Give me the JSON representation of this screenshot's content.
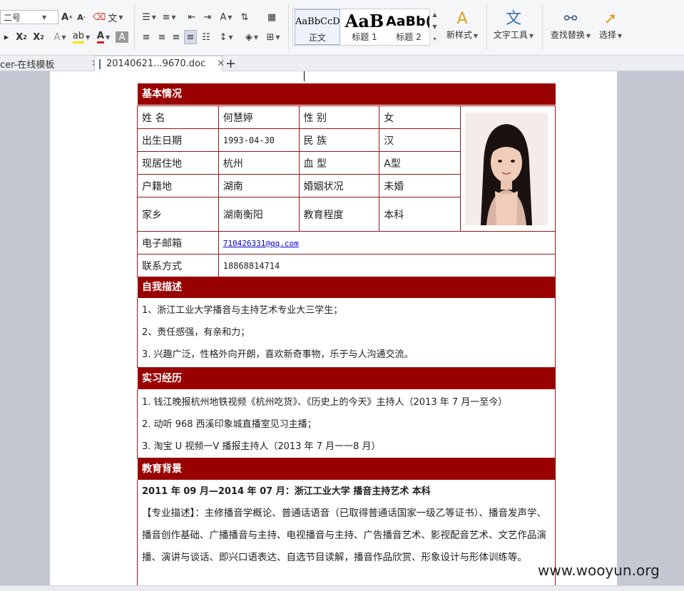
{
  "ribbon": {
    "font_size_value": "二号",
    "styles": [
      {
        "sample": "AaBbCcD",
        "name": "正文"
      },
      {
        "sample": "AaB",
        "name": "标题 1"
      },
      {
        "sample": "AaBb(",
        "name": "标题 2"
      }
    ],
    "new_style_label": "新样式",
    "text_tools_label": "文字工具",
    "find_replace_label": "查找替换",
    "select_label": "选择"
  },
  "doc_tabs": [
    {
      "label": "cer-在线模板"
    },
    {
      "label": "20140621...9670.doc"
    }
  ],
  "resume": {
    "sections": {
      "basic": "基本情况",
      "self": "自我描述",
      "intern": "实习经历",
      "edu": "教育背景"
    },
    "fields": {
      "name_label": "姓 名",
      "name": "何慧婷",
      "gender_label": "性 别",
      "gender": "女",
      "birth_label": "出生日期",
      "birth": "1993-04-30",
      "ethnic_label": "民 族",
      "ethnic": "汉",
      "residence_label": "现居住地",
      "residence": "杭州",
      "blood_label": "血 型",
      "blood": "A型",
      "hukou_label": "户籍地",
      "hukou": "湖南",
      "marital_label": "婚姻状况",
      "marital": "未婚",
      "hometown_label": "家乡",
      "hometown": "湖南衡阳",
      "degree_label": "教育程度",
      "degree": "本科",
      "email_label": "电子邮箱",
      "email": "710426331@qq.com",
      "phone_label": "联系方式",
      "phone": "18868814714"
    },
    "self_lines": [
      "1、浙江工业大学播音与主持艺术专业大三学生；",
      "2、责任感强，有亲和力；",
      "3. 兴趣广泛，性格外向开朗，喜欢新奇事物，乐于与人沟通交流。"
    ],
    "intern_lines": [
      "1.  钱江晚报杭州地铁视频《杭州吃货》、《历史上的今天》主持人（2013 年 7 月一至今）",
      "2.  动听 968 西溪印象城直播室见习主播；",
      "3.  淘宝 U 视频一V 播报主持人（2013 年 7 月一一8 月）"
    ],
    "edu_title": "2011 年 09 月—2014 年 07 月：浙江工业大学   播音主持艺术   本科",
    "edu_desc": "【专业描述】：主修播音学概论、普通话语音（已取得普通话国家一级乙等证书）、播音发声学、播音创作基础、广播播音与主持、电视播音与主持、广告播音艺术、影视配音艺术、文艺作品演播、演讲与谈话、即兴口语表达、自选节目读解，播音作品欣赏、形象设计与形体训练等。"
  },
  "watermark": "www.wooyun.org"
}
